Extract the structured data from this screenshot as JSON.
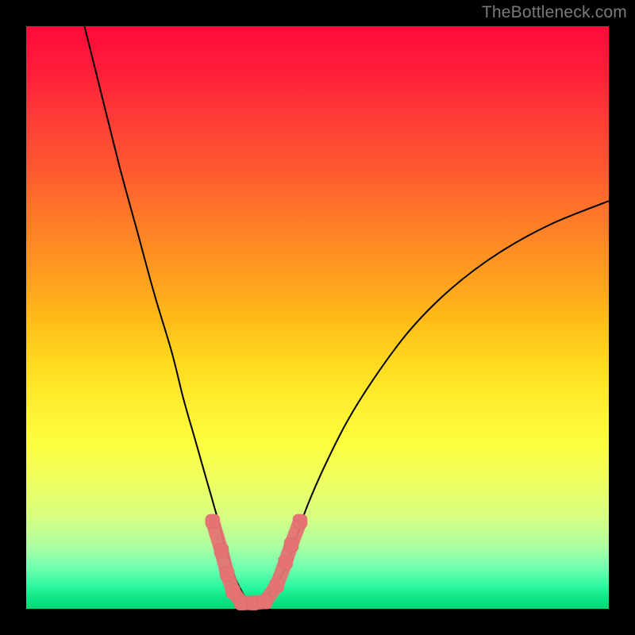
{
  "watermark": "TheBottleneck.com",
  "colors": {
    "frame": "#000000",
    "marker": "#e57373",
    "curve": "#000000"
  },
  "chart_data": {
    "type": "line",
    "title": "",
    "xlabel": "",
    "ylabel": "",
    "xlim": [
      0,
      100
    ],
    "ylim": [
      0,
      100
    ],
    "grid": false,
    "legend": false,
    "series": [
      {
        "name": "bottleneck-curve",
        "x": [
          10,
          13,
          16,
          19,
          22,
          25,
          27,
          29,
          31,
          33,
          34,
          35,
          36,
          37,
          38,
          39,
          40,
          42,
          44,
          46,
          48,
          51,
          55,
          60,
          66,
          73,
          81,
          90,
          100
        ],
        "y": [
          100,
          88,
          76,
          65,
          54,
          44,
          36,
          29,
          22,
          15,
          11,
          8,
          5,
          3,
          1.5,
          1,
          1.5,
          3,
          6,
          11,
          17,
          24,
          32,
          40,
          48,
          55,
          61,
          66,
          70
        ]
      }
    ],
    "markers": {
      "name": "highlight-points",
      "points": [
        {
          "x": 32,
          "y": 15
        },
        {
          "x": 33.5,
          "y": 10
        },
        {
          "x": 34.5,
          "y": 6
        },
        {
          "x": 35.5,
          "y": 3
        },
        {
          "x": 37,
          "y": 1
        },
        {
          "x": 39,
          "y": 1
        },
        {
          "x": 41,
          "y": 1.2
        },
        {
          "x": 43,
          "y": 4
        },
        {
          "x": 44.5,
          "y": 8
        },
        {
          "x": 45.5,
          "y": 11
        },
        {
          "x": 47,
          "y": 15
        }
      ]
    }
  }
}
